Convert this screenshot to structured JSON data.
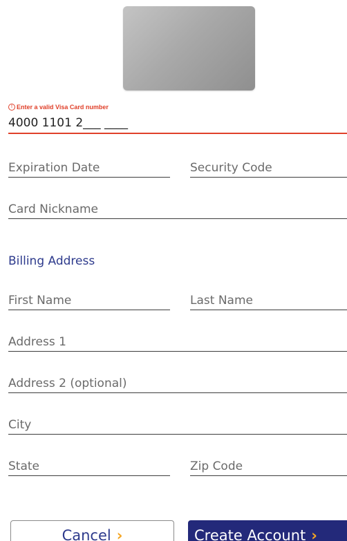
{
  "card": {
    "error_icon": "!",
    "error_message": "Enter a valid Visa Card number",
    "number_value": "4000 1101 2___ ____"
  },
  "fields": {
    "expiration_placeholder": "Expiration Date",
    "security_placeholder": "Security Code",
    "nickname_placeholder": "Card Nickname"
  },
  "billing": {
    "heading": "Billing Address",
    "first_name_placeholder": "First Name",
    "last_name_placeholder": "Last Name",
    "address1_placeholder": "Address 1",
    "address2_placeholder": "Address 2 (optional)",
    "city_placeholder": "City",
    "state_placeholder": "State",
    "zip_placeholder": "Zip Code"
  },
  "actions": {
    "cancel_label": "Cancel",
    "create_label": "Create Account",
    "chevron": "›"
  },
  "colors": {
    "accent": "#23297a",
    "heading": "#2d3a8c",
    "error": "#e0402a",
    "chevron": "#f5a623"
  }
}
